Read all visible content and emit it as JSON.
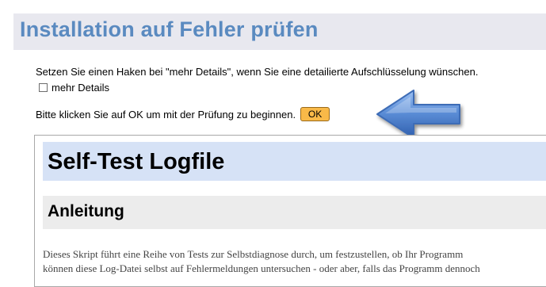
{
  "header": {
    "title": "Installation auf Fehler prüfen"
  },
  "instructions": {
    "details_hint": "Setzen Sie einen Haken bei \"mehr Details\", wenn Sie eine detailierte Aufschlüsselung wünschen.",
    "details_checkbox_label": "mehr Details",
    "details_checked": false,
    "ok_prompt": "Bitte klicken Sie auf OK um mit der Prüfung zu beginnen.",
    "ok_button_label": "OK"
  },
  "logfile": {
    "title": "Self-Test Logfile",
    "section_heading": "Anleitung",
    "intro_line_1": "Dieses Skript führt eine Reihe von Tests zur Selbstdiagnose durch, um festzustellen, ob Ihr Programm",
    "intro_line_2": "können diese Log-Datei selbst auf Fehlermeldungen untersuchen - oder aber, falls das Programm dennoch"
  },
  "colors": {
    "header_bg": "#e8e8ef",
    "header_title": "#5a8ac0",
    "ok_button": "#f9b948",
    "log_title_bg": "#d6e2f6",
    "section_bg": "#ececec",
    "arrow": "#4a78c4"
  },
  "icons": {
    "arrow": "left-pointing-arrow-icon",
    "checkbox": "checkbox-icon"
  }
}
